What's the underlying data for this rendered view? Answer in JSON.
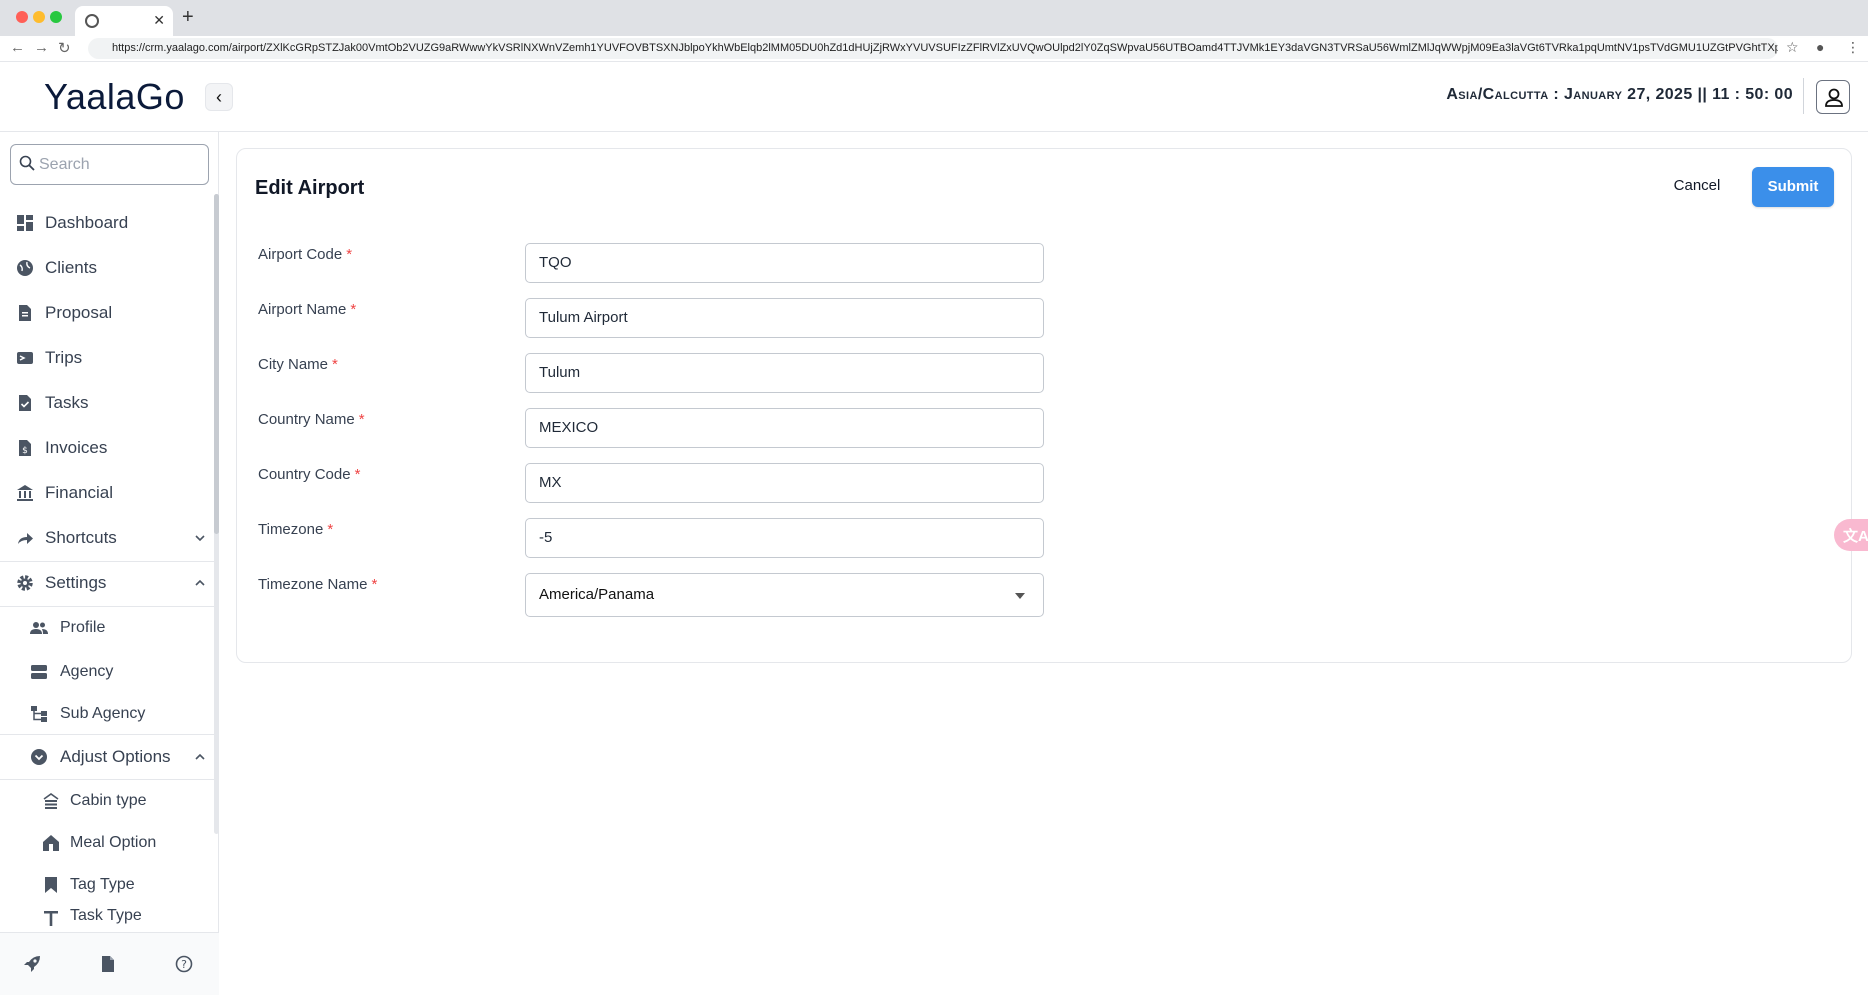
{
  "browser": {
    "url": "https://crm.yaalago.com/airport/ZXlKcGRpSTZJak00VmtOb2VUZG9aRWwwYkVSRlNXWnVZemh1YUVFOVBTSXNJblpoYkhWbElqb2lMM05DU0hZd1dHUjZjRWxYVUVSUFIzZFlRVlZxUVQwOUlpd2lY0ZqSWpvaU56UTBOamd4TTJVMk1EY3daVGN3TVRSaU56WmlZMlJqWWpjM09Ea3laVGt6TVRka1pqUmtNV1psTVdGMU1UZGtPVGhtTXp..."
  },
  "header": {
    "logo": "YaalaGo",
    "clock": "Asia/Calcutta : January 27, 2025 || 11 : 50: 00"
  },
  "sidebar": {
    "search_placeholder": "Search",
    "items": [
      {
        "label": "Dashboard"
      },
      {
        "label": "Clients"
      },
      {
        "label": "Proposal"
      },
      {
        "label": "Trips"
      },
      {
        "label": "Tasks"
      },
      {
        "label": "Invoices"
      },
      {
        "label": "Financial"
      },
      {
        "label": "Shortcuts"
      },
      {
        "label": "Settings"
      }
    ],
    "settings_children": [
      {
        "label": "Profile"
      },
      {
        "label": "Agency"
      },
      {
        "label": "Sub Agency"
      },
      {
        "label": "Adjust Options"
      }
    ],
    "adjust_children": [
      {
        "label": "Cabin type"
      },
      {
        "label": "Meal Option"
      },
      {
        "label": "Tag Type"
      },
      {
        "label": "Task Type"
      }
    ]
  },
  "form": {
    "title": "Edit Airport",
    "cancel_label": "Cancel",
    "submit_label": "Submit",
    "fields": [
      {
        "label": "Airport Code",
        "value": "TQO"
      },
      {
        "label": "Airport Name",
        "value": "Tulum Airport"
      },
      {
        "label": "City Name",
        "value": "Tulum"
      },
      {
        "label": "Country Name",
        "value": "MEXICO"
      },
      {
        "label": "Country Code",
        "value": "MX"
      },
      {
        "label": "Timezone",
        "value": "-5"
      },
      {
        "label": "Timezone Name",
        "value": "America/Panama"
      }
    ],
    "required_marker": "*"
  },
  "colors": {
    "accent": "#3b8fea",
    "required": "#ef4444"
  }
}
